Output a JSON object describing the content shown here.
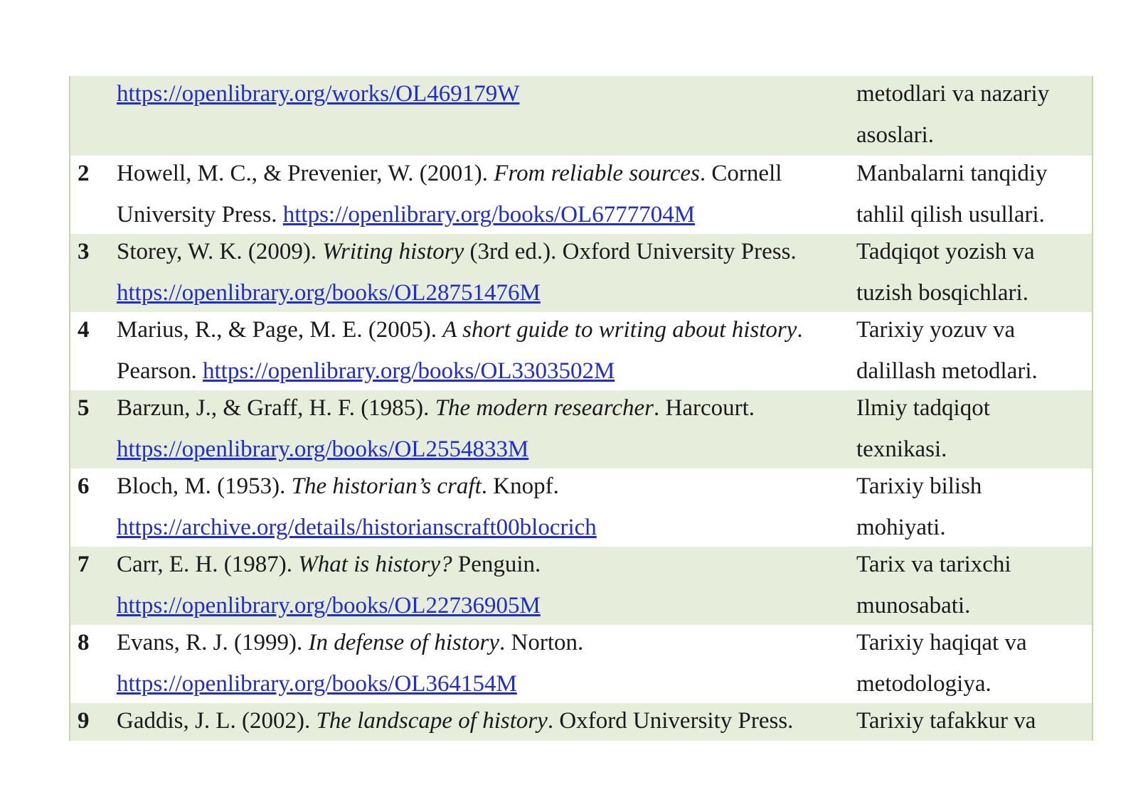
{
  "rows": [
    {
      "num": "",
      "authors": "",
      "title": "",
      "publisher": "",
      "url": "https://openlibrary.org/works/OL469179W",
      "note": "metodlari va nazariy asoslari."
    },
    {
      "num": "2",
      "authors": "Howell, M. C., & Prevenier, W. (2001). ",
      "title": "From reliable sources",
      "publisher": ". Cornell University Press. ",
      "url": "https://openlibrary.org/books/OL6777704M",
      "note_line1": "Manbalarni tanqidiy",
      "note_line2": "tahlil qilish usullari."
    },
    {
      "num": "3",
      "authors": "Storey, W. K. (2009). ",
      "title": "Writing history",
      "publisher": " (3rd ed.). Oxford University Press.",
      "url": "https://openlibrary.org/books/OL28751476M",
      "note_line1": "Tadqiqot yozish va",
      "note_line2": "tuzish bosqichlari."
    },
    {
      "num": "4",
      "authors": "Marius, R., & Page, M. E. (2005). ",
      "title": "A short guide to writing about history",
      "publisher": ". Pearson. ",
      "url": "https://openlibrary.org/books/OL3303502M",
      "note_line1": "Tarixiy yozuv va",
      "note_line2": "dalillash metodlari."
    },
    {
      "num": "5",
      "authors": "Barzun, J., & Graff, H. F. (1985). ",
      "title": "The modern researcher",
      "publisher": ". Harcourt.",
      "url": "https://openlibrary.org/books/OL2554833M",
      "note_line1": "Ilmiy tadqiqot",
      "note_line2": "texnikasi."
    },
    {
      "num": "6",
      "authors": "Bloch, M. (1953). ",
      "title": "The historian’s craft",
      "publisher": ". Knopf.",
      "url": "https://archive.org/details/historianscraft00blocrich",
      "note_line1": "Tarixiy bilish",
      "note_line2": "mohiyati."
    },
    {
      "num": "7",
      "authors": "Carr, E. H. (1987). ",
      "title": "What is history?",
      "publisher": " Penguin.",
      "url": "https://openlibrary.org/books/OL22736905M",
      "note_line1": "Tarix va tarixchi",
      "note_line2": "munosabati."
    },
    {
      "num": "8",
      "authors": "Evans, R. J. (1999). ",
      "title": "In defense of history",
      "publisher": ". Norton.",
      "url": "https://openlibrary.org/books/OL364154M",
      "note_line1": "Tarixiy haqiqat va",
      "note_line2": "metodologiya."
    },
    {
      "num": "9",
      "authors": "Gaddis, J. L. (2002). ",
      "title": "The landscape of history",
      "publisher": ". Oxford University Press.",
      "note_line1": "Tarixiy tafakkur va"
    }
  ],
  "first_row_note": {
    "line1": "metodlari va nazariy",
    "line2": "asoslari."
  }
}
